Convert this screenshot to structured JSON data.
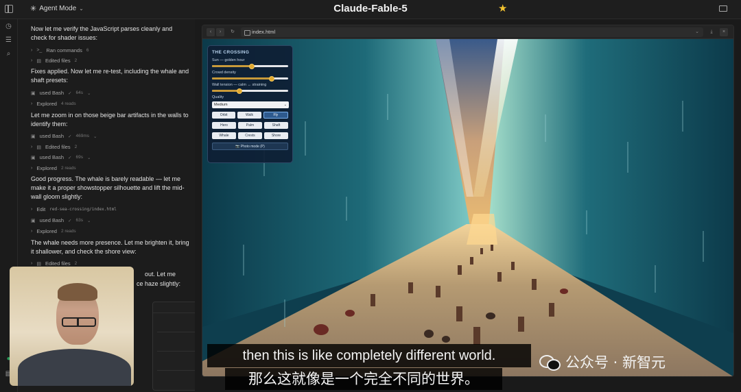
{
  "app": {
    "title": "Claude-Fable-5",
    "mode_label": "Agent Mode",
    "star_color": "#f4c430"
  },
  "chat": {
    "messages": [
      {
        "id": "m1",
        "text": "Now let me verify the JavaScript parses cleanly and check for shader issues:"
      },
      {
        "id": "m2",
        "text": "Fixes applied. Now let me re-test, including the whale and shaft presets:"
      },
      {
        "id": "m3",
        "text": "Let me zoom in on those beige bar artifacts in the walls to identify them:"
      },
      {
        "id": "m4",
        "text": "Good progress. The whale is barely readable — let me make it a proper showstopper silhouette and lift the mid-wall gloom slightly:"
      },
      {
        "id": "m5",
        "text": "The whale needs more presence. Let me brighten it, bring it shallower, and check the shore view:"
      },
      {
        "id": "m6",
        "text": "out. Let me"
      },
      {
        "id": "m7",
        "text": "ce haze slightly:"
      }
    ],
    "tools": [
      {
        "label": "Ran commands",
        "count": "6"
      },
      {
        "label": "Edited files",
        "count": "2"
      },
      {
        "label": "used Bash",
        "time": "64s"
      },
      {
        "label": "Explored",
        "count": "4 reads"
      },
      {
        "label": "used Bash",
        "time": "469ms"
      },
      {
        "label": "Edited files",
        "count": "2"
      },
      {
        "label": "used Bash",
        "time": "69s"
      },
      {
        "label": "Explored",
        "count": "2 reads"
      },
      {
        "label": "Edit",
        "path": "red-sea-crossing/index.html"
      },
      {
        "label": "used Bash",
        "time": "63s"
      },
      {
        "label": "Explored",
        "count": "2 reads"
      },
      {
        "label": "Edited files",
        "count": "2"
      }
    ]
  },
  "browser": {
    "url": "index.html"
  },
  "controls": {
    "heading": "THE CROSSING",
    "sun_label": "Sun — golden hour",
    "sun_value": 0.52,
    "crowd_label": "Crowd density",
    "crowd_value": 0.78,
    "wall_label": "Wall tension — calm ↔ straining",
    "wall_value": 0.36,
    "quality_label": "Quality",
    "quality_value": "Medium",
    "camera_modes": [
      "Orbit",
      "Walk",
      "Fly"
    ],
    "active_camera": "Fly",
    "presets_row1": [
      "Hero",
      "Palm",
      "Shaft"
    ],
    "presets_row2": [
      "Whale",
      "Crests",
      "Shore"
    ],
    "photo_button": "📷 Photo mode (P)"
  },
  "subtitles": {
    "english": "then this is like completely different world.",
    "chinese": "那么这就像是一个完全不同的世界。"
  },
  "watermark": "公众号 · 新智元"
}
